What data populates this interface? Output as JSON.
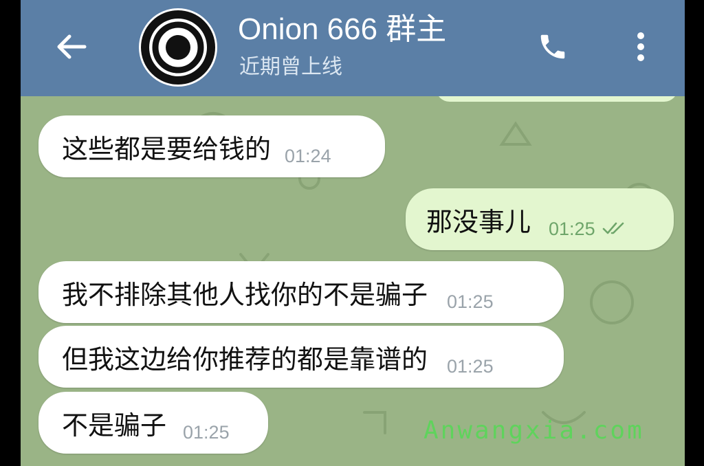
{
  "header": {
    "title": "Onion 666 群主",
    "status": "近期曾上线",
    "back_icon": "arrow-left-icon",
    "call_icon": "phone-icon",
    "menu_icon": "more-vertical-icon"
  },
  "messages": [
    {
      "direction": "incoming",
      "text": "这些都是要给钱的",
      "time": "01:24"
    },
    {
      "direction": "outgoing",
      "text": "那没事儿",
      "time": "01:25",
      "status": "read-double-check"
    },
    {
      "direction": "incoming",
      "text": "我不排除其他人找你的不是骗子",
      "time": "01:25"
    },
    {
      "direction": "incoming",
      "text": "但我这边给你推荐的都是靠谱的",
      "time": "01:25"
    },
    {
      "direction": "incoming",
      "text": "不是骗子",
      "time": "01:25"
    }
  ],
  "watermark": "Anwangxia.com",
  "colors": {
    "header": "#5b7fa6",
    "chat_background": "#9ab486",
    "incoming_bubble": "#ffffff",
    "outgoing_bubble": "#e3f6cf",
    "watermark": "#5fd35c"
  }
}
